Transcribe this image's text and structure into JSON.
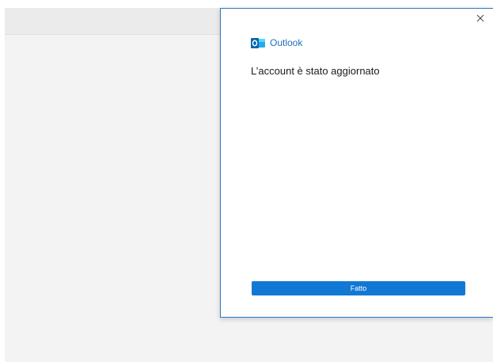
{
  "dialog": {
    "app_name": "Outlook",
    "title": "L’account è stato aggiornato",
    "done_label": "Fatto"
  },
  "icons": {
    "close": "close-icon",
    "brand": "outlook-logo-icon"
  },
  "colors": {
    "accent": "#1179d4",
    "brand_text": "#1f6fbe",
    "dialog_border": "#2b78c6",
    "backdrop": "#f3f3f3"
  }
}
